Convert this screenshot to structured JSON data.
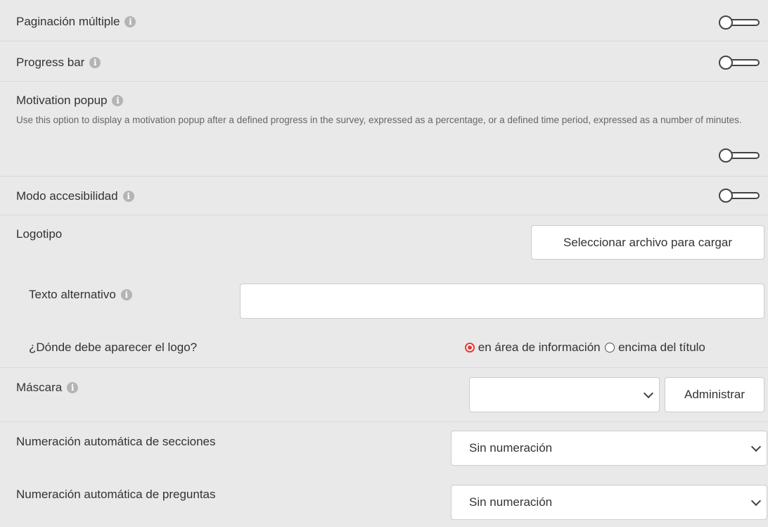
{
  "settings": {
    "multipage": {
      "label": "Paginación múltiple",
      "enabled": false
    },
    "progress_bar": {
      "label": "Progress bar",
      "enabled": false
    },
    "motivation_popup": {
      "label": "Motivation popup",
      "description": "Use this option to display a motivation popup after a defined progress in the survey, expressed as a percentage, or a defined time period, expressed as a number of minutes.",
      "enabled": false
    },
    "accessibility": {
      "label": "Modo accesibilidad",
      "enabled": false
    },
    "logo": {
      "label": "Logotipo",
      "upload_button": "Seleccionar archivo para cargar",
      "alt_text_label": "Texto alternativo",
      "alt_text_value": "",
      "position_question": "¿Dónde debe aparecer el logo?",
      "position_options": [
        "en área de información",
        "encima del título"
      ],
      "position_selected": "en área de información"
    },
    "mask": {
      "label": "Máscara",
      "selected": "",
      "manage_button": "Administrar"
    },
    "section_numbering": {
      "label": "Numeración automática de secciones",
      "selected": "Sin numeración"
    },
    "question_numbering": {
      "label": "Numeración automática de preguntas",
      "selected": "Sin numeración"
    }
  },
  "icons": {
    "info": "info-icon",
    "toggle": "toggle-switch",
    "dropdown": "chevron-down-icon"
  },
  "colors": {
    "background": "#e9e9e9",
    "radio_selected": "#e53935",
    "info_icon": "#b4b4b4"
  }
}
